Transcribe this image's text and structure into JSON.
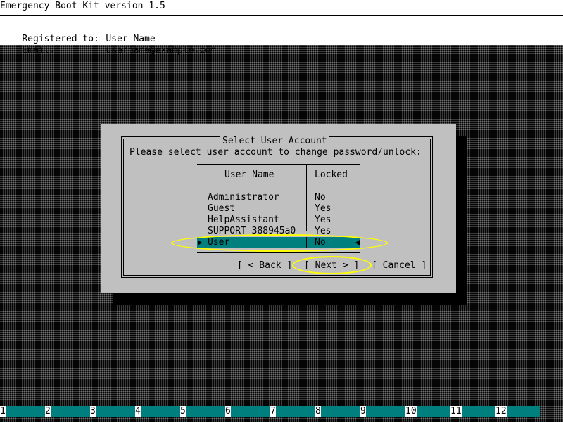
{
  "app": {
    "title": "Emergency Boot Kit version 1.5"
  },
  "registration": {
    "registered_label": "Registered to:",
    "registered_value": "User Name",
    "email_label": "Email:",
    "email_value": "username@example.com"
  },
  "dialog": {
    "title": "Select User Account",
    "prompt": "Please select user account to change password/unlock:",
    "columns": [
      "User Name",
      "Locked"
    ],
    "users": [
      {
        "name": "Administrator",
        "locked": "No"
      },
      {
        "name": "Guest",
        "locked": "Yes"
      },
      {
        "name": "HelpAssistant",
        "locked": "Yes"
      },
      {
        "name": "SUPPORT_388945a0",
        "locked": "Yes"
      },
      {
        "name": "User",
        "locked": "No"
      }
    ],
    "selected_index": 4,
    "buttons": {
      "back": "[ < Back ]",
      "next": "[ Next > ]",
      "cancel": "[ Cancel ]"
    }
  },
  "fkeys": [
    "1",
    "2",
    "3",
    "4",
    "5",
    "6",
    "7",
    "8",
    "9",
    "10",
    "11",
    "12"
  ],
  "colors": {
    "selection": "#007f7f",
    "dialog_bg": "#c0c0c0",
    "highlight": "#ffff00"
  }
}
